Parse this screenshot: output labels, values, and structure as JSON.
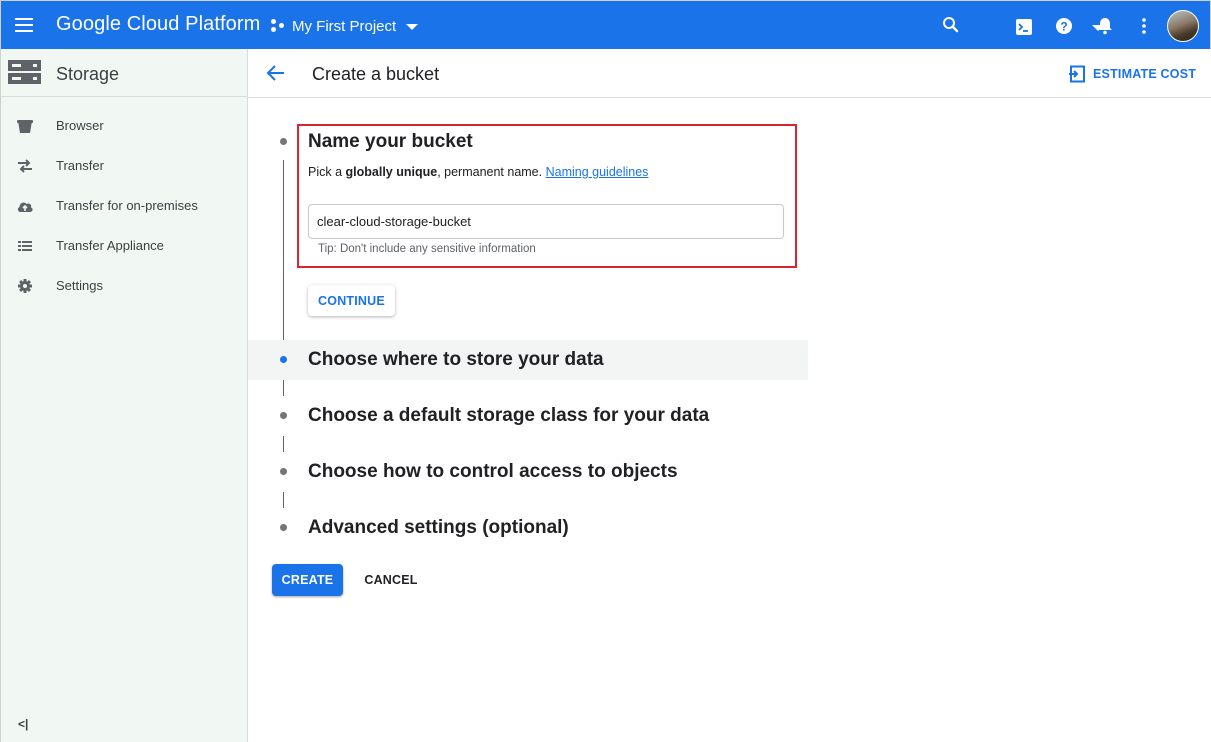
{
  "topbar": {
    "app_title": "Google Cloud Platform",
    "project_name": "My First Project",
    "bg_color": "#1a73e8",
    "icons": [
      "menu-icon",
      "project-icon",
      "search-icon",
      "cloud-shell-icon",
      "help-icon",
      "notifications-icon",
      "more-vert-icon",
      "avatar"
    ]
  },
  "sidebar": {
    "title": "Storage",
    "items": [
      {
        "label": "Browser",
        "icon": "bucket-icon"
      },
      {
        "label": "Transfer",
        "icon": "transfer-icon"
      },
      {
        "label": "Transfer for on-premises",
        "icon": "cloud-upload-icon"
      },
      {
        "label": "Transfer Appliance",
        "icon": "list-icon"
      },
      {
        "label": "Settings",
        "icon": "gear-icon"
      }
    ],
    "collapse_label": "<|"
  },
  "header": {
    "title": "Create a bucket",
    "estimate_label": "ESTIMATE COST"
  },
  "step1": {
    "title": "Name your bucket",
    "desc_pre": "Pick a ",
    "desc_bold": "globally unique",
    "desc_post": ", permanent name. ",
    "desc_link": "Naming guidelines",
    "input_value": "clear-cloud-storage-bucket",
    "tip": "Tip: Don't include any sensitive information",
    "continue_label": "CONTINUE"
  },
  "steps": [
    {
      "title": "Choose where to store your data",
      "active": true
    },
    {
      "title": "Choose a default storage class for your data",
      "active": false
    },
    {
      "title": "Choose how to control access to objects",
      "active": false
    },
    {
      "title": "Advanced settings (optional)",
      "active": false
    }
  ],
  "actions": {
    "create_label": "CREATE",
    "cancel_label": "CANCEL"
  },
  "colors": {
    "accent": "#1a73e8",
    "highlight_border": "#d9232e",
    "sidebar_bg": "#f1f8f3"
  }
}
